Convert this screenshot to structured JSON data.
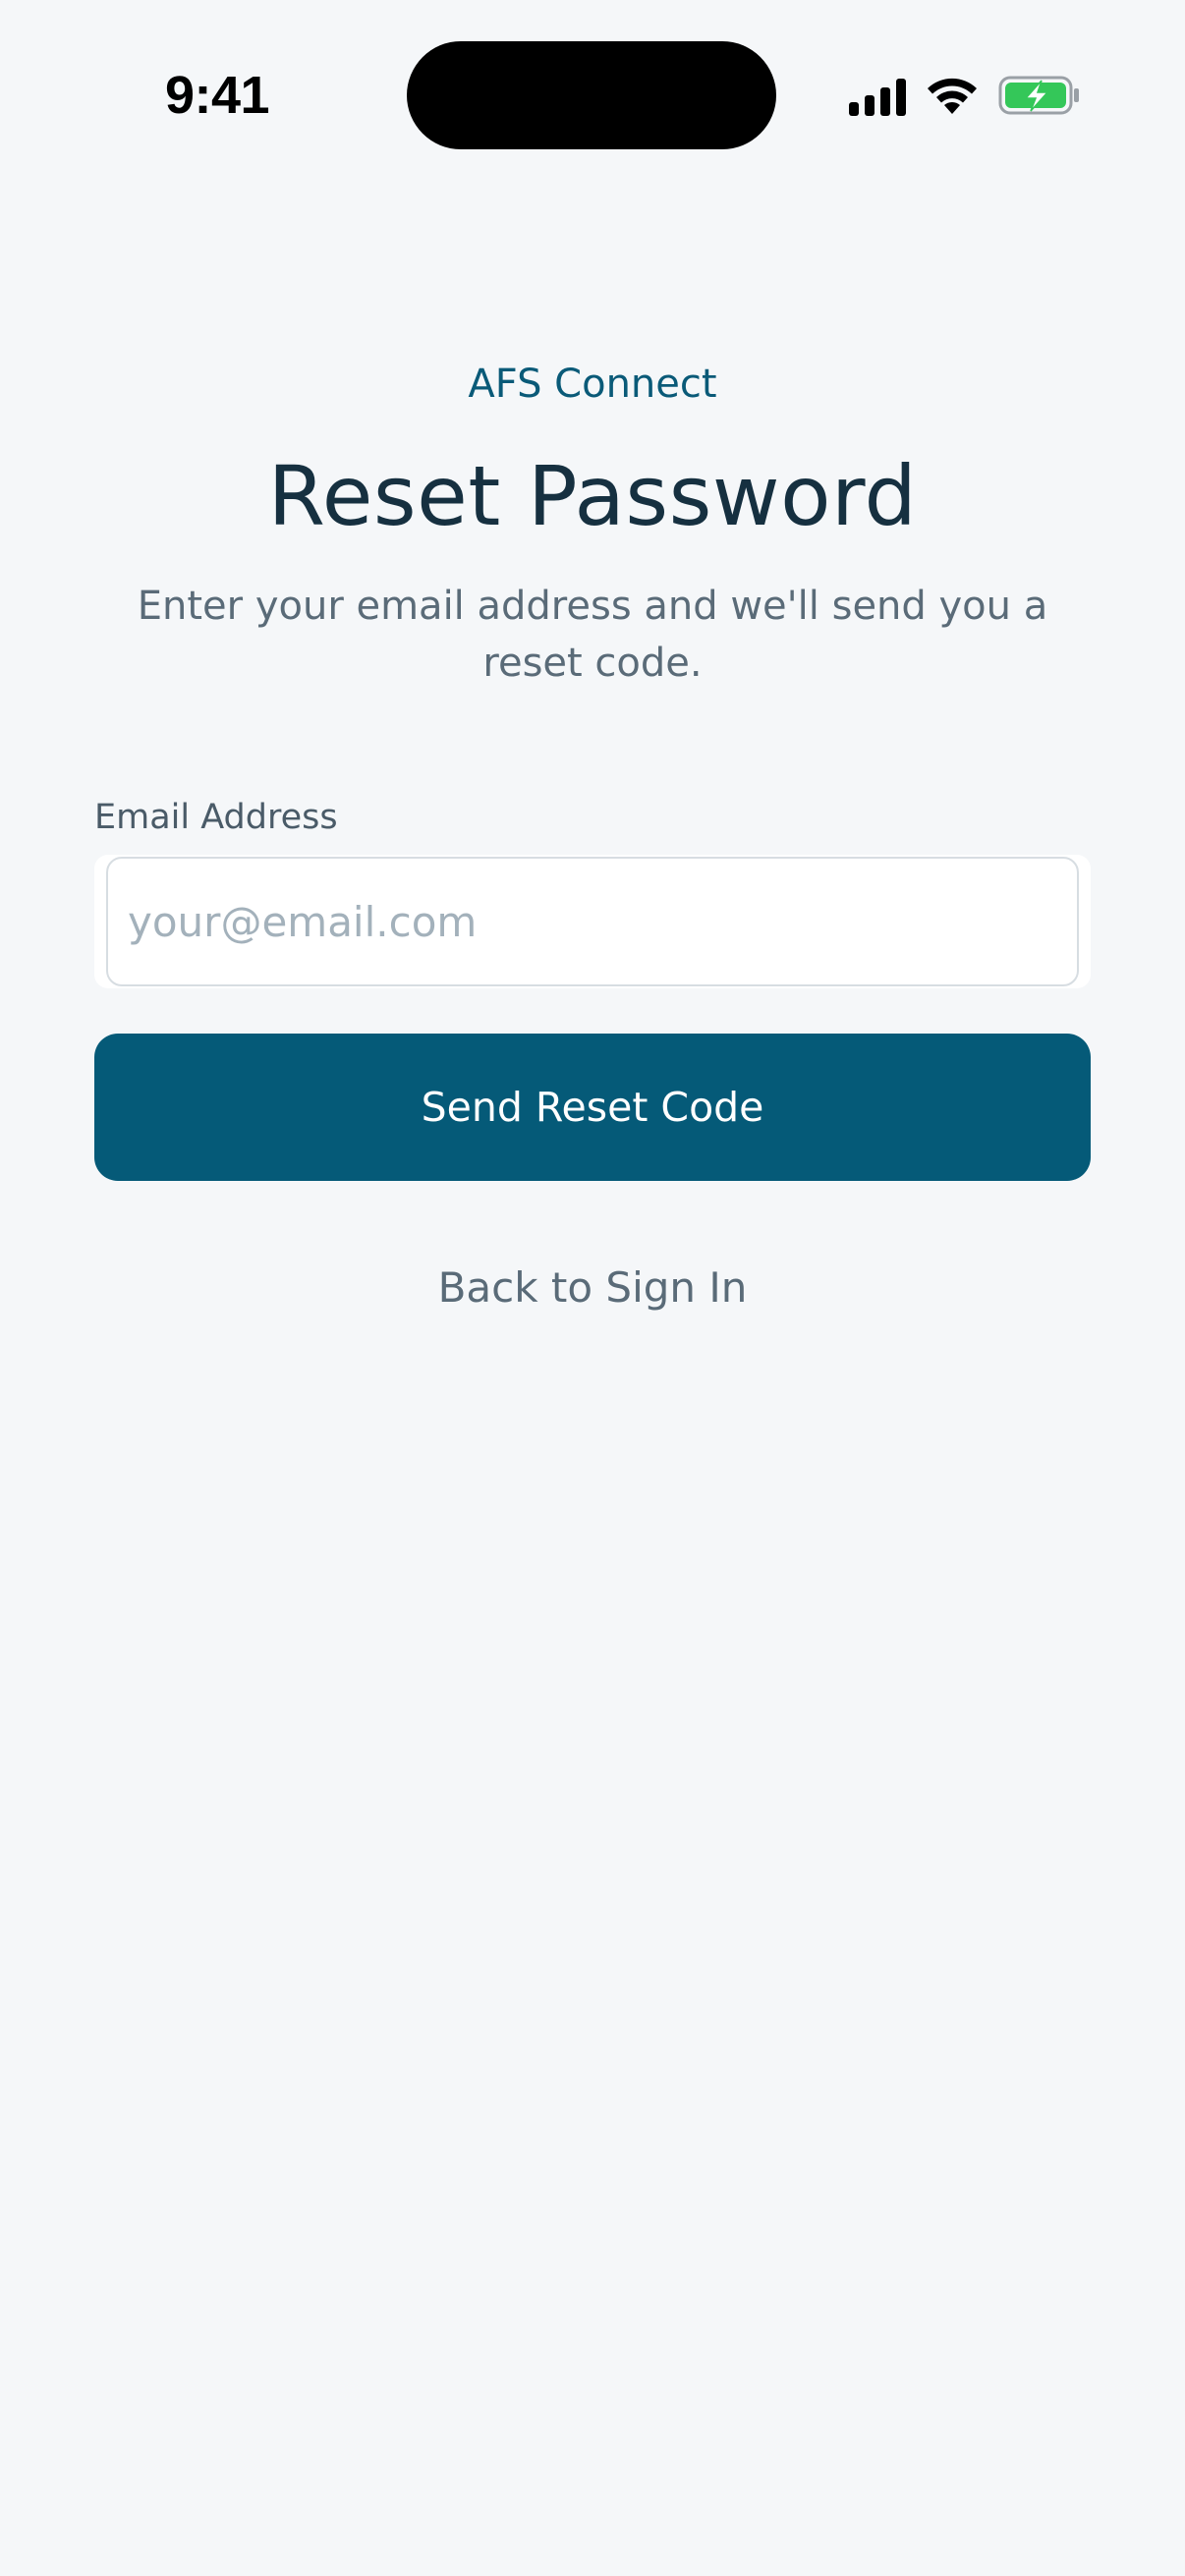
{
  "status_bar": {
    "time": "9:41",
    "icons": [
      "signal-icon",
      "wifi-icon",
      "battery-charging-icon"
    ],
    "battery_color": "#34c759"
  },
  "header": {
    "brand": "AFS Connect",
    "title": "Reset Password",
    "subtitle": "Enter your email address and we'll send you a reset code."
  },
  "form": {
    "email_label": "Email Address",
    "email_placeholder": "your@email.com",
    "email_value": "",
    "submit_label": "Send Reset Code"
  },
  "footer": {
    "back_link": "Back to Sign In"
  },
  "colors": {
    "background": "#f5f7f9",
    "primary": "#055a78",
    "brand_text": "#0a5a78",
    "title_text": "#163040",
    "muted_text": "#5a6b78"
  }
}
